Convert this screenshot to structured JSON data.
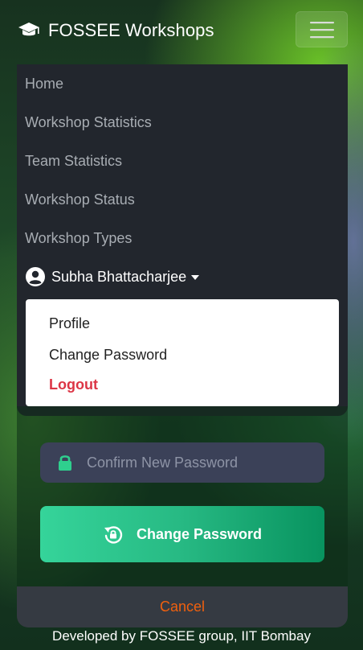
{
  "navbar": {
    "brand_icon": "graduation-cap-icon",
    "brand_text": "FOSSEE Workshops",
    "toggler_icon": "hamburger-icon"
  },
  "menu": {
    "items": [
      {
        "label": "Home"
      },
      {
        "label": "Workshop Statistics"
      },
      {
        "label": "Team Statistics"
      },
      {
        "label": "Workshop Status"
      },
      {
        "label": "Workshop Types"
      }
    ],
    "user": {
      "icon": "user-circle-icon",
      "name": "Subha Bhattacharjee"
    },
    "dropdown": {
      "profile": "Profile",
      "change_password": "Change Password",
      "logout": "Logout"
    }
  },
  "form": {
    "confirm_password": {
      "placeholder": "Confirm New Password",
      "value": ""
    },
    "submit_label": "Change Password",
    "cancel_label": "Cancel"
  },
  "footer": {
    "text": "Developed by FOSSEE group, IIT Bombay"
  },
  "colors": {
    "accent": "#27b983",
    "danger": "#dc3545",
    "cancel": "#f0600e",
    "menu_bg": "#22262d"
  }
}
